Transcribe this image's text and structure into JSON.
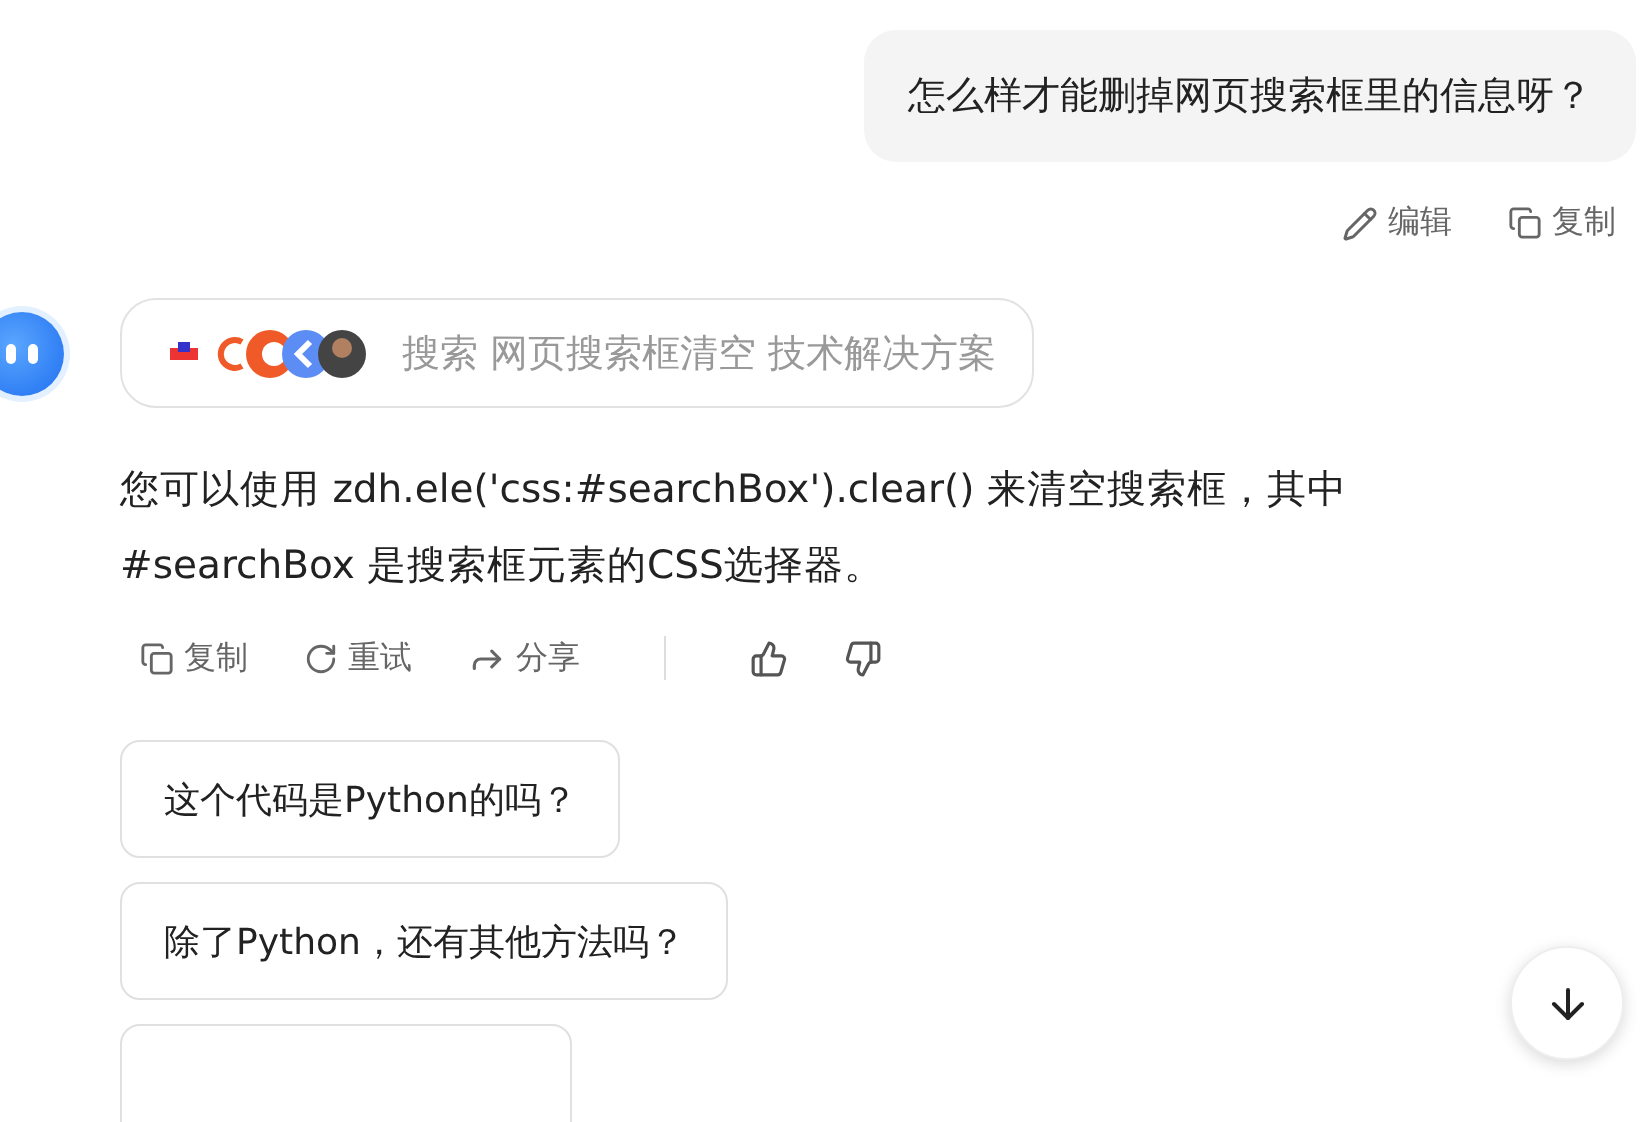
{
  "user_message": {
    "text": "怎么样才能删掉网页搜索框里的信息呀？",
    "actions": [
      {
        "kind": "edit",
        "label": "编辑"
      },
      {
        "kind": "copy",
        "label": "复制"
      }
    ]
  },
  "answer": {
    "search_chip": "搜索 网页搜索框清空 技术解决方案",
    "text": "您可以使用 zdh.ele('css:#searchBox').clear() 来清空搜索框，其中 #searchBox 是搜索框元素的CSS选择器。",
    "actions": [
      {
        "kind": "copy",
        "label": "复制"
      },
      {
        "kind": "retry",
        "label": "重试"
      },
      {
        "kind": "share",
        "label": "分享"
      }
    ],
    "feedback": [
      {
        "kind": "like"
      },
      {
        "kind": "dislike"
      }
    ]
  },
  "suggestions": [
    {
      "kind": "text",
      "text": "这个代码是Python的吗？"
    },
    {
      "kind": "text",
      "text": "除了Python，还有其他方法吗？"
    },
    {
      "kind": "cut_off"
    }
  ]
}
